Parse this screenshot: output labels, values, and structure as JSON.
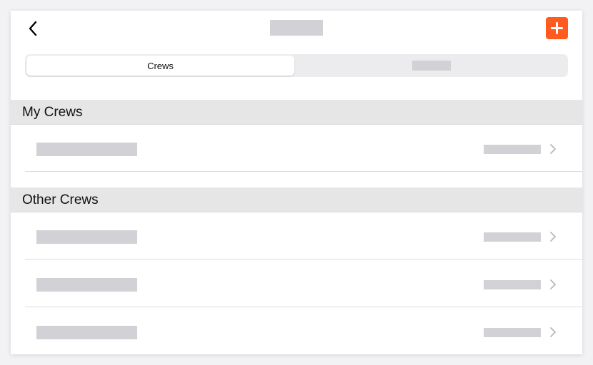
{
  "header": {
    "back_icon": "chevron-left-icon",
    "add_icon": "plus-icon",
    "accent_color": "#ff5a1f"
  },
  "segmented": {
    "active_label": "Crews"
  },
  "sections": {
    "my_crews": {
      "title": "My Crews"
    },
    "other_crews": {
      "title": "Other Crews"
    }
  }
}
